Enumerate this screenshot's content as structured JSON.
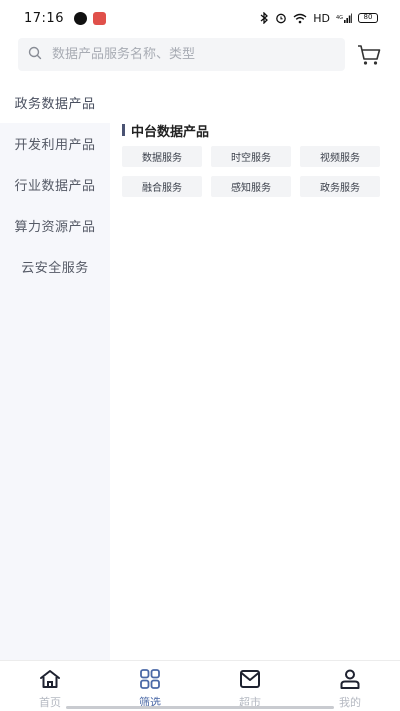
{
  "status_bar": {
    "time": "17:16",
    "network": "HD",
    "signal": "4G",
    "battery": "80"
  },
  "search": {
    "placeholder": "数据产品服务名称、类型"
  },
  "sidebar": {
    "items": [
      {
        "label": "政务数据产品",
        "active": true
      },
      {
        "label": "开发利用产品",
        "active": false
      },
      {
        "label": "行业数据产品",
        "active": false
      },
      {
        "label": "算力资源产品",
        "active": false
      },
      {
        "label": "云安全服务",
        "active": false
      }
    ]
  },
  "main": {
    "section_title": "中台数据产品",
    "tags": [
      "数据服务",
      "时空服务",
      "视频服务",
      "融合服务",
      "感知服务",
      "政务服务"
    ]
  },
  "tabbar": {
    "tabs": [
      {
        "label": "首页",
        "icon": "home-icon",
        "active": false
      },
      {
        "label": "筛选",
        "icon": "grid-icon",
        "active": true
      },
      {
        "label": "超市",
        "icon": "market-icon",
        "active": false
      },
      {
        "label": "我的",
        "icon": "user-icon",
        "active": false
      }
    ]
  },
  "colors": {
    "accent": "#4a68a6",
    "sidebar_bg": "#f6f7fb",
    "tag_bg": "#f3f4f6",
    "inactive_tab": "#b5b9c2"
  }
}
